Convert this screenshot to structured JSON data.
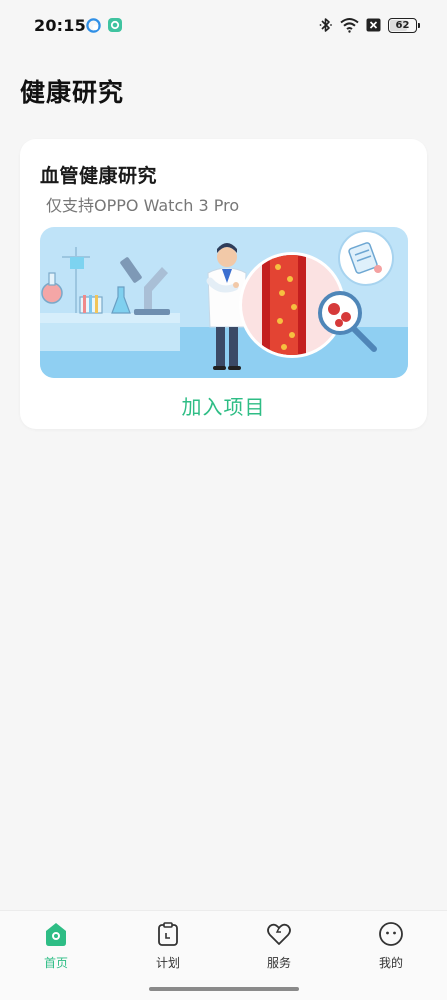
{
  "status_bar": {
    "time": "20:15",
    "battery_level": "62",
    "icons": [
      "app-notification-icon",
      "app-notification-icon-2",
      "bluetooth-icon",
      "wifi-icon",
      "no-sim-icon",
      "battery-icon"
    ]
  },
  "page": {
    "title": "健康研究"
  },
  "card": {
    "title": "血管健康研究",
    "subtitle": "仅支持OPPO Watch 3 Pro",
    "join_label": "加入项目"
  },
  "bottom_nav": {
    "items": [
      {
        "label": "首页",
        "icon": "home-icon",
        "active": true
      },
      {
        "label": "计划",
        "icon": "plan-clipboard-icon",
        "active": false
      },
      {
        "label": "服务",
        "icon": "heart-icon",
        "active": false
      },
      {
        "label": "我的",
        "icon": "profile-face-icon",
        "active": false
      }
    ]
  },
  "colors": {
    "accent": "#2ebd85",
    "background": "#f6f6f6",
    "card": "#ffffff"
  }
}
